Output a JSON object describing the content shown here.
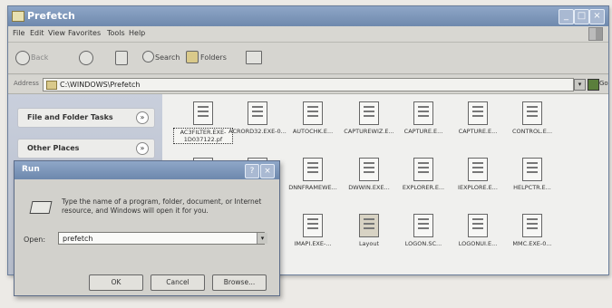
{
  "window": {
    "title": "Prefetch"
  },
  "menu": [
    "File",
    "Edit",
    "View",
    "Favorites",
    "Tools",
    "Help"
  ],
  "toolbar": {
    "back": "Back",
    "search": "Search",
    "folders": "Folders"
  },
  "address": {
    "label": "Address",
    "value": "C:\\WINDOWS\\Prefetch",
    "go": "Go"
  },
  "tasks": [
    {
      "label": "File and Folder Tasks"
    },
    {
      "label": "Other Places"
    }
  ],
  "files": [
    {
      "name": "AC3FILTER.EXE-1D037122.pf",
      "icon": "document-icon",
      "selected": true
    },
    {
      "name": "ACRORD32.EXE-0...",
      "icon": "document-icon"
    },
    {
      "name": "AUTOCHK.E...",
      "icon": "document-icon"
    },
    {
      "name": "CAPTUREWIZ.E...",
      "icon": "document-icon"
    },
    {
      "name": "CAPTURE.E...",
      "icon": "document-icon"
    },
    {
      "name": "CAPTURE.E...",
      "icon": "document-icon"
    },
    {
      "name": "CONTROL.E...",
      "icon": "document-icon"
    },
    {
      "name": "",
      "icon": "document-icon"
    },
    {
      "name": "",
      "icon": "document-icon"
    },
    {
      "name": "DNNFRAMEWE...",
      "icon": "document-icon"
    },
    {
      "name": "DWWIN.EXE...",
      "icon": "document-icon"
    },
    {
      "name": "EXPLORER.E...",
      "icon": "document-icon"
    },
    {
      "name": "IEXPLORE.E...",
      "icon": "document-icon"
    },
    {
      "name": "HELPCTR.E...",
      "icon": "document-icon"
    },
    {
      "name": "",
      "icon": "document-icon"
    },
    {
      "name": "",
      "icon": "document-icon"
    },
    {
      "name": "IMAPI.EXE-...",
      "icon": "document-icon"
    },
    {
      "name": "Layout",
      "icon": "layout-icon"
    },
    {
      "name": "LOGON.SC...",
      "icon": "document-icon"
    },
    {
      "name": "LOGONUI.E...",
      "icon": "document-icon"
    },
    {
      "name": "MMC.EXE-0...",
      "icon": "document-icon"
    }
  ],
  "run": {
    "title": "Run",
    "description": "Type the name of a program, folder, document, or Internet resource, and Windows will open it for you.",
    "open_label": "Open:",
    "open_value": "prefetch",
    "ok": "OK",
    "cancel": "Cancel",
    "browse": "Browse..."
  }
}
